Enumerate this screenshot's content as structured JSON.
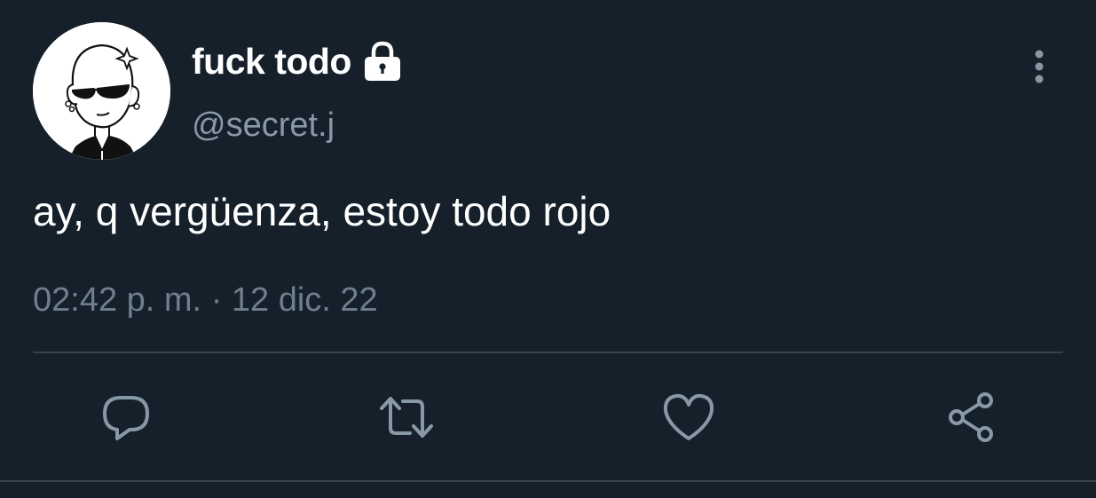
{
  "tweet": {
    "display_name": "fuck todo",
    "handle": "@secret.j",
    "text": "ay, q vergüenza, estoy todo rojo",
    "time": "02:42 p. m.",
    "separator": "·",
    "date": "12 dic. 22"
  },
  "icons": {
    "lock": "lock-icon",
    "more": "vertical-ellipsis-icon",
    "reply": "speech-bubble-icon",
    "retweet": "retweet-arrows-icon",
    "like": "heart-icon",
    "share": "share-nodes-icon"
  },
  "colors": {
    "background": "#15202b",
    "primary_text": "#ffffff",
    "secondary_text": "#8899a6",
    "divider": "#38444d"
  }
}
